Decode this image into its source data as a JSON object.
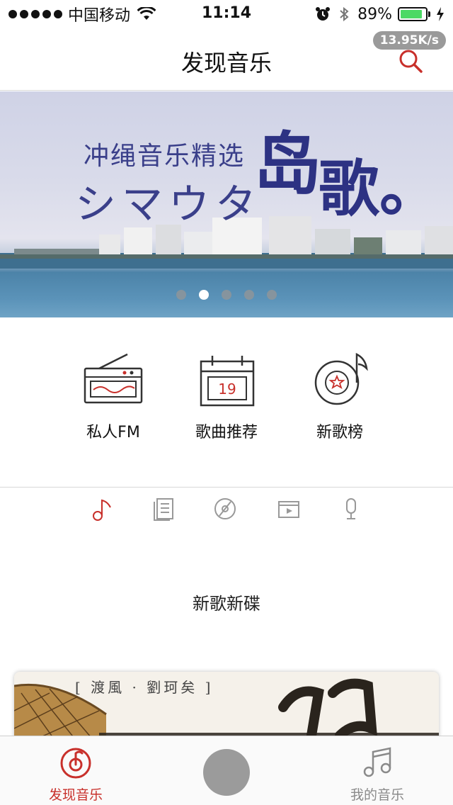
{
  "status_bar": {
    "carrier": "中国移动",
    "time": "11:14",
    "battery_percent": "89%",
    "battery_level": 0.89,
    "icons": [
      "signal-dots",
      "wifi-icon",
      "alarm-icon",
      "bluetooth-icon",
      "battery-icon",
      "charging-icon"
    ]
  },
  "header": {
    "title": "发现音乐",
    "network_speed": "13.95K/s",
    "search_icon": "search-icon"
  },
  "banner": {
    "subtitle": "冲绳音乐精选",
    "kana": "シマウタ",
    "big_char_1": "岛",
    "big_char_2": "歌。",
    "slide_count": 5,
    "active_slide": 2
  },
  "features": [
    {
      "label": "私人FM",
      "icon": "radio-icon"
    },
    {
      "label": "歌曲推荐",
      "icon": "calendar-icon",
      "calendar_day": "19"
    },
    {
      "label": "新歌榜",
      "icon": "chart-disc-icon"
    }
  ],
  "category_tabs": [
    {
      "icon": "music-note-icon",
      "active": true
    },
    {
      "icon": "document-icon",
      "active": false
    },
    {
      "icon": "disc-icon",
      "active": false
    },
    {
      "icon": "video-icon",
      "active": false
    },
    {
      "icon": "microphone-icon",
      "active": false
    }
  ],
  "section": {
    "title": "新歌新碟"
  },
  "album": {
    "caption": "[ 渡風 · 劉珂矣 ]"
  },
  "tabbar": {
    "items": [
      {
        "label": "发现音乐",
        "icon": "netease-music-icon",
        "active": true
      },
      {
        "label": "我的音乐",
        "icon": "music-notes-icon",
        "active": false
      }
    ]
  },
  "colors": {
    "accent": "#c8302b",
    "inactive": "#8a8a8a",
    "banner_text": "#2d3283"
  }
}
